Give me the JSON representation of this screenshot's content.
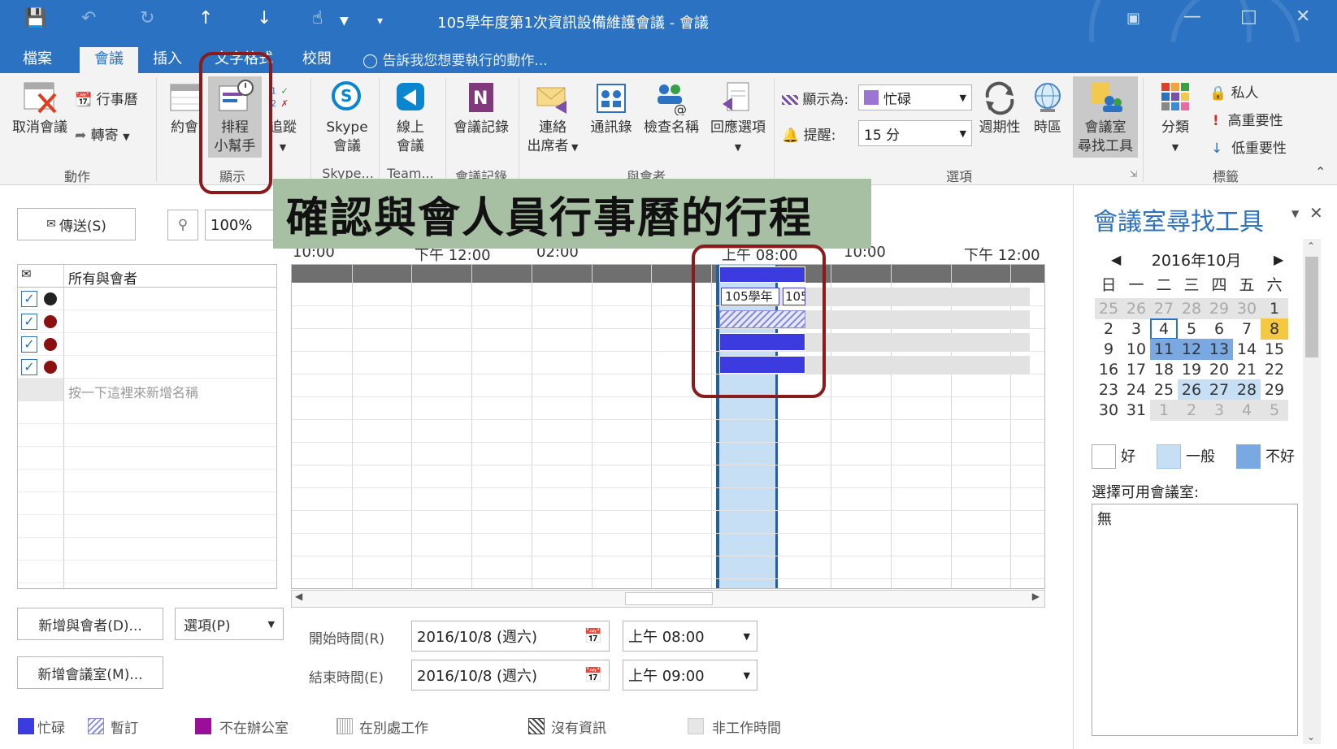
{
  "window": {
    "title": "105學年度第1次資訊設備維護會議 - 會議"
  },
  "tabs": {
    "file": "檔案",
    "meeting": "會議",
    "insert": "插入",
    "format": "文字格式",
    "review": "校閱",
    "tell_me": "告訴我您想要執行的動作..."
  },
  "ribbon": {
    "actions": {
      "cancel": "取消會議",
      "calendar": "行事曆",
      "forward": "轉寄",
      "label": "動作"
    },
    "show": {
      "appointment": "約會",
      "assistant_1": "排程",
      "assistant_2": "小幫手",
      "tracking": "追蹤",
      "label": "顯示"
    },
    "skype": {
      "btn_1": "Skype",
      "btn_2": "會議",
      "label": "Skype..."
    },
    "teams": {
      "btn_1": "線上",
      "btn_2": "會議",
      "label": "Team..."
    },
    "notes": {
      "btn": "會議記錄",
      "label": "會議記錄"
    },
    "attendees": {
      "contact_1": "連絡",
      "contact_2": "出席者",
      "address_book": "通訊錄",
      "check_names": "檢查名稱",
      "response": "回應選項",
      "label": "與會者"
    },
    "options": {
      "show_as_label": "顯示為:",
      "show_as_value": "忙碌",
      "reminder_label": "提醒:",
      "reminder_value": "15 分",
      "recurrence": "週期性",
      "timezone": "時區",
      "room_finder_1": "會議室",
      "room_finder_2": "尋找工具",
      "label": "選項"
    },
    "tags": {
      "categorize": "分類",
      "private": "私人",
      "high": "高重要性",
      "low": "低重要性",
      "label": "標籤"
    }
  },
  "callout": "確認與會人員行事曆的行程",
  "toolbar": {
    "send": "傳送(S)",
    "zoom": "100%"
  },
  "timeline": {
    "t1": "10:00",
    "t2": "下午 12:00",
    "t3": "02:00",
    "t4": "上午 08:00",
    "t5": "10:00",
    "t6": "下午 12:00"
  },
  "attendees_list": {
    "header": "所有與會者",
    "add_hint": "按一下這裡來新增名稱"
  },
  "meeting_blocks": {
    "label_a": "105學年",
    "label_b": "105"
  },
  "bottom": {
    "add_attendee": "新增與會者(D)...",
    "options": "選項(P)",
    "add_room": "新增會議室(M)...",
    "start_label": "開始時間(R)",
    "start_date": "2016/10/8 (週六)",
    "start_time": "上午 08:00",
    "end_label": "結束時間(E)",
    "end_date": "2016/10/8 (週六)",
    "end_time": "上午 09:00"
  },
  "legend": {
    "busy": "忙碌",
    "tentative": "暫訂",
    "oof": "不在辦公室",
    "elsewhere": "在別處工作",
    "noinfo": "沒有資訊",
    "offhours": "非工作時間"
  },
  "room_finder": {
    "title": "會議室尋找工具",
    "month": "2016年10月",
    "weekdays": [
      "日",
      "一",
      "二",
      "三",
      "四",
      "五",
      "六"
    ],
    "weeks": [
      [
        "25",
        "26",
        "27",
        "28",
        "29",
        "30",
        "1"
      ],
      [
        "2",
        "3",
        "4",
        "5",
        "6",
        "7",
        "8"
      ],
      [
        "9",
        "10",
        "11",
        "12",
        "13",
        "14",
        "15"
      ],
      [
        "16",
        "17",
        "18",
        "19",
        "20",
        "21",
        "22"
      ],
      [
        "23",
        "24",
        "25",
        "26",
        "27",
        "28",
        "29"
      ],
      [
        "30",
        "31",
        "1",
        "2",
        "3",
        "4",
        "5"
      ]
    ],
    "legend_good": "好",
    "legend_fair": "一般",
    "legend_poor": "不好",
    "rooms_label": "選擇可用會議室:",
    "rooms_value": "無"
  },
  "colors": {
    "accent": "#2b72c2",
    "busy": "#3b3be0",
    "selection": "#c6dff5",
    "callout": "#a7bfa2",
    "highlight_border": "#8b1a1a"
  }
}
